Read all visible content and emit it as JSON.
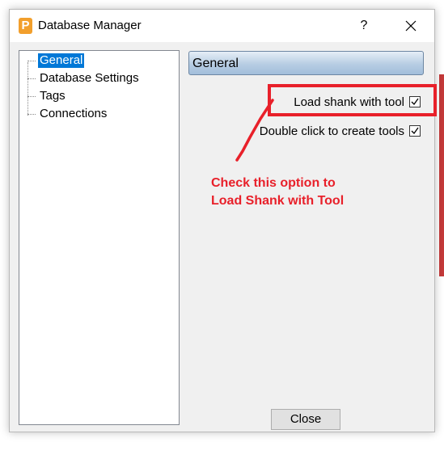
{
  "window": {
    "title": "Database Manager",
    "app_icon_letter": "P",
    "help_label": "?"
  },
  "tree": {
    "items": [
      {
        "label": "General",
        "selected": true
      },
      {
        "label": "Database Settings",
        "selected": false
      },
      {
        "label": "Tags",
        "selected": false
      },
      {
        "label": "Connections",
        "selected": false
      }
    ]
  },
  "panel": {
    "header": "General",
    "options": [
      {
        "label": "Load shank with tool",
        "checked": true
      },
      {
        "label": "Double click to create tools",
        "checked": true
      }
    ]
  },
  "footer": {
    "close_label": "Close"
  },
  "annotation": {
    "line1": "Check this option to",
    "line2": "Load Shank with Tool",
    "color": "#e8202a"
  },
  "colors": {
    "selection": "#0078d7",
    "app_icon": "#f29f2c"
  }
}
